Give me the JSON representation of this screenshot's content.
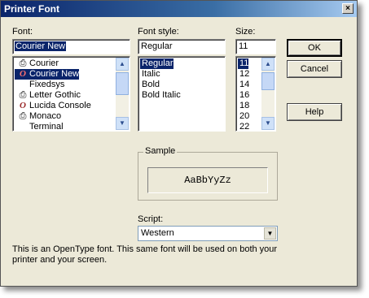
{
  "window": {
    "title": "Printer Font",
    "close_glyph": "×"
  },
  "font": {
    "label": "Font:",
    "value": "Courier New",
    "items": [
      {
        "icon": "printer-icon",
        "label": "Courier",
        "selected": false
      },
      {
        "icon": "opentype-icon",
        "label": "Courier New",
        "selected": true
      },
      {
        "icon": "",
        "label": "Fixedsys",
        "selected": false
      },
      {
        "icon": "printer-icon",
        "label": "Letter Gothic",
        "selected": false
      },
      {
        "icon": "opentype-icon",
        "label": "Lucida Console",
        "selected": false
      },
      {
        "icon": "printer-icon",
        "label": "Monaco",
        "selected": false
      },
      {
        "icon": "",
        "label": "Terminal",
        "selected": false
      }
    ]
  },
  "font_style": {
    "label": "Font style:",
    "value": "Regular",
    "items": [
      {
        "label": "Regular",
        "selected": true
      },
      {
        "label": "Italic",
        "selected": false
      },
      {
        "label": "Bold",
        "selected": false
      },
      {
        "label": "Bold Italic",
        "selected": false
      }
    ]
  },
  "size": {
    "label": "Size:",
    "value": "11",
    "items": [
      {
        "label": "11",
        "selected": true
      },
      {
        "label": "12",
        "selected": false
      },
      {
        "label": "14",
        "selected": false
      },
      {
        "label": "16",
        "selected": false
      },
      {
        "label": "18",
        "selected": false
      },
      {
        "label": "20",
        "selected": false
      },
      {
        "label": "22",
        "selected": false
      }
    ]
  },
  "buttons": {
    "ok": "OK",
    "cancel": "Cancel",
    "help": "Help"
  },
  "sample": {
    "label": "Sample",
    "text": "AaBbYyZz"
  },
  "script": {
    "label": "Script:",
    "value": "Western"
  },
  "description": "This is an OpenType font. This same font will be used on both your printer and your screen.",
  "colors": {
    "selection": "#0a246a",
    "dialog_bg": "#ece9d8",
    "titlebar": "#0a246a"
  }
}
